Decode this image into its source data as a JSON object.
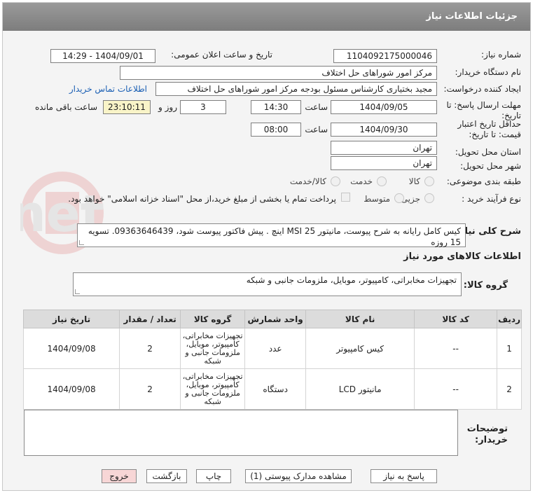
{
  "header": {
    "title": "جزئیات اطلاعات نیاز"
  },
  "form": {
    "need_number_label": "شماره نیاز:",
    "need_number": "1104092175000046",
    "announce_label": "تاریخ و ساعت اعلان عمومی:",
    "announce_value": "1404/09/01 - 14:29",
    "buyer_org_label": "نام دستگاه خریدار:",
    "buyer_org": "مرکز امور شوراهای حل اختلاف",
    "creator_label": "ایجاد کننده درخواست:",
    "creator": "مجید بختیاری کارشناس مسئول بودجه مرکز امور شوراهای حل اختلاف",
    "contact_link": "اطلاعات تماس خریدار",
    "deadline_label_1": "مهلت ارسال پاسخ: تا",
    "deadline_label_2": "تاریخ:",
    "deadline_date": "1404/09/05",
    "time_label": "ساعت",
    "deadline_time": "14:30",
    "days": "3",
    "days_label": "روز و",
    "remaining": "23:10:11",
    "remaining_label": "ساعت باقی مانده",
    "validity_label_1": "حداقل تاریخ اعتبار",
    "validity_label_2": "قیمت: تا تاریخ:",
    "validity_date": "1404/09/30",
    "validity_time": "08:00",
    "province_label": "استان محل تحویل:",
    "province": "تهران",
    "city_label": "شهر محل تحویل:",
    "city": "تهران",
    "category_label": "طبقه بندی موضوعی:",
    "category_options": [
      "کالا",
      "خدمت",
      "کالا/خدمت"
    ],
    "process_label": "نوع فرآیند خرید :",
    "process_options": [
      "جزیی",
      "متوسط"
    ],
    "payment_note": "پرداخت تمام یا بخشی از مبلغ خرید،از محل \"اسناد خزانه اسلامی\" خواهد بود."
  },
  "description": {
    "label": "شرح کلی نیاز:",
    "text": "کیس کامل رایانه به شرح پیوست، مانیتور 25 MSI اینچ . پیش فاکتور پیوست شود، 09363646439. تسویه 15 روزه"
  },
  "goods": {
    "section_title": "اطلاعات کالاهای مورد نیاز",
    "group_label": "گروه کالا:",
    "group_value": "تجهیزات مخابراتی، کامپیوتر، موبایل، ملزومات جانبی و شبکه",
    "columns": [
      "ردیف",
      "کد کالا",
      "نام کالا",
      "واحد شمارش",
      "گروه کالا",
      "تعداد / مقدار",
      "تاریخ نیاز"
    ],
    "rows": [
      {
        "row": "1",
        "code": "--",
        "name": "کیس کامپیوتر",
        "unit": "عدد",
        "group": "تجهیزات مخابراتی، کامپیوتر، موبایل، ملزومات جانبی و شبکه",
        "qty": "2",
        "date": "1404/09/08"
      },
      {
        "row": "2",
        "code": "--",
        "name": "مانیتور LCD",
        "unit": "دستگاه",
        "group": "تجهیزات مخابراتی، کامپیوتر، موبایل، ملزومات جانبی و شبکه",
        "qty": "2",
        "date": "1404/09/08"
      }
    ]
  },
  "buyer_notes": {
    "label_1": "توضیحات",
    "label_2": "خریدار:",
    "text": ""
  },
  "buttons": {
    "reply": "پاسخ به نیاز",
    "attachments": "مشاهده مدارک پیوستی (1)",
    "print": "چاپ",
    "back": "بازگشت",
    "exit": "خروج"
  },
  "colors": {
    "header": "#8a8a8a",
    "link": "#1a5fb4",
    "remaining_bg": "#f9f4c8",
    "exit_bg": "#f7d6d6"
  }
}
